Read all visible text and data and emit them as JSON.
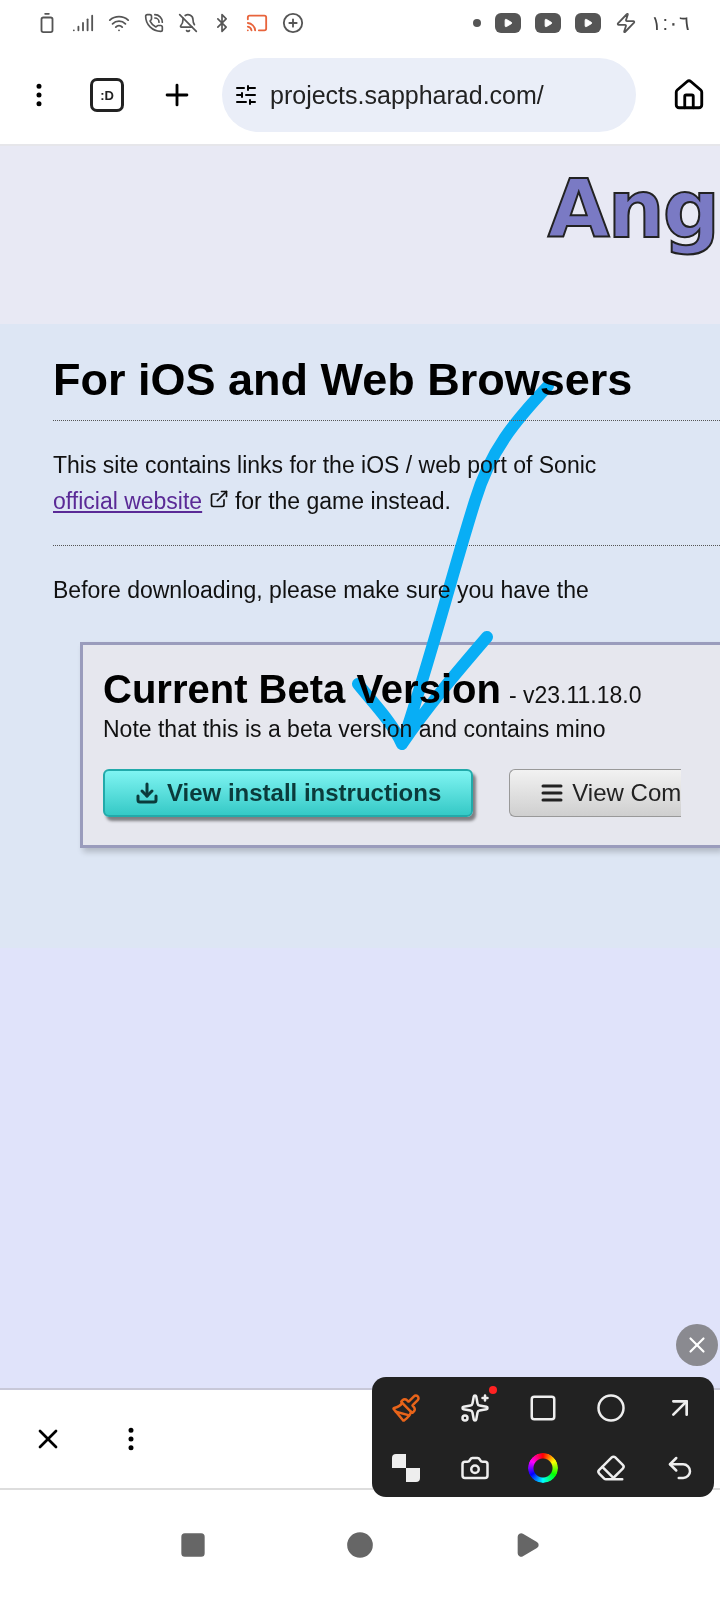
{
  "status_bar": {
    "time": "١:٠٦"
  },
  "browser": {
    "url": "projects.sappharad.com/",
    "tab_badge": ":D"
  },
  "page": {
    "logo": "Ang",
    "heading": "For iOS and Web Browsers",
    "intro": {
      "text": "This site contains links for the iOS / web port of Sonic",
      "link": "official website",
      "after": "for the game instead."
    },
    "before": "Before downloading, please make sure you have the",
    "beta": {
      "title": "Current Beta Version",
      "version": "- v23.11.18.0",
      "note": "Note that this is a beta version and contains mino",
      "buttons": [
        {
          "label": "View install instructions",
          "kind": "primary"
        },
        {
          "label": "View Com",
          "kind": "secondary"
        }
      ]
    }
  },
  "annotation_tools": [
    {
      "kind": "brush",
      "selected": true
    },
    {
      "kind": "magic",
      "selected": false
    },
    {
      "kind": "rectangle",
      "selected": false
    },
    {
      "kind": "circle",
      "selected": false
    },
    {
      "kind": "arrow",
      "selected": false
    },
    {
      "kind": "mosaic",
      "selected": false
    },
    {
      "kind": "camera",
      "selected": false
    },
    {
      "kind": "color",
      "selected": false
    },
    {
      "kind": "eraser",
      "selected": false
    },
    {
      "kind": "undo",
      "selected": false
    }
  ]
}
